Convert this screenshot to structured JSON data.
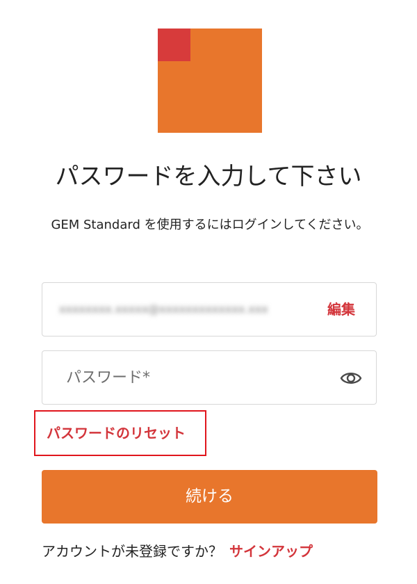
{
  "brand": {
    "logo_primary_color": "#e8762c",
    "logo_accent_color": "#d73b3b"
  },
  "header": {
    "title": "パスワードを入力して下さい",
    "subtitle": "GEM Standard を使用するにはログインしてください。"
  },
  "email_field": {
    "value": "xxxxxxxx.xxxxx@xxxxxxxxxxxxx.xxx",
    "edit_label": "編集"
  },
  "password_field": {
    "placeholder": "パスワード*",
    "value": "",
    "toggle_icon": "eye-icon"
  },
  "reset_link": {
    "label": "パスワードのリセット",
    "highlight_color": "#e0151c"
  },
  "continue_button": {
    "label": "続ける",
    "color": "#e8762c"
  },
  "signup": {
    "question": "アカウントが未登録ですか？",
    "link_label": "サインアップ"
  },
  "colors": {
    "link": "#d3353b",
    "border": "#d7d7d7",
    "text": "#222222"
  }
}
